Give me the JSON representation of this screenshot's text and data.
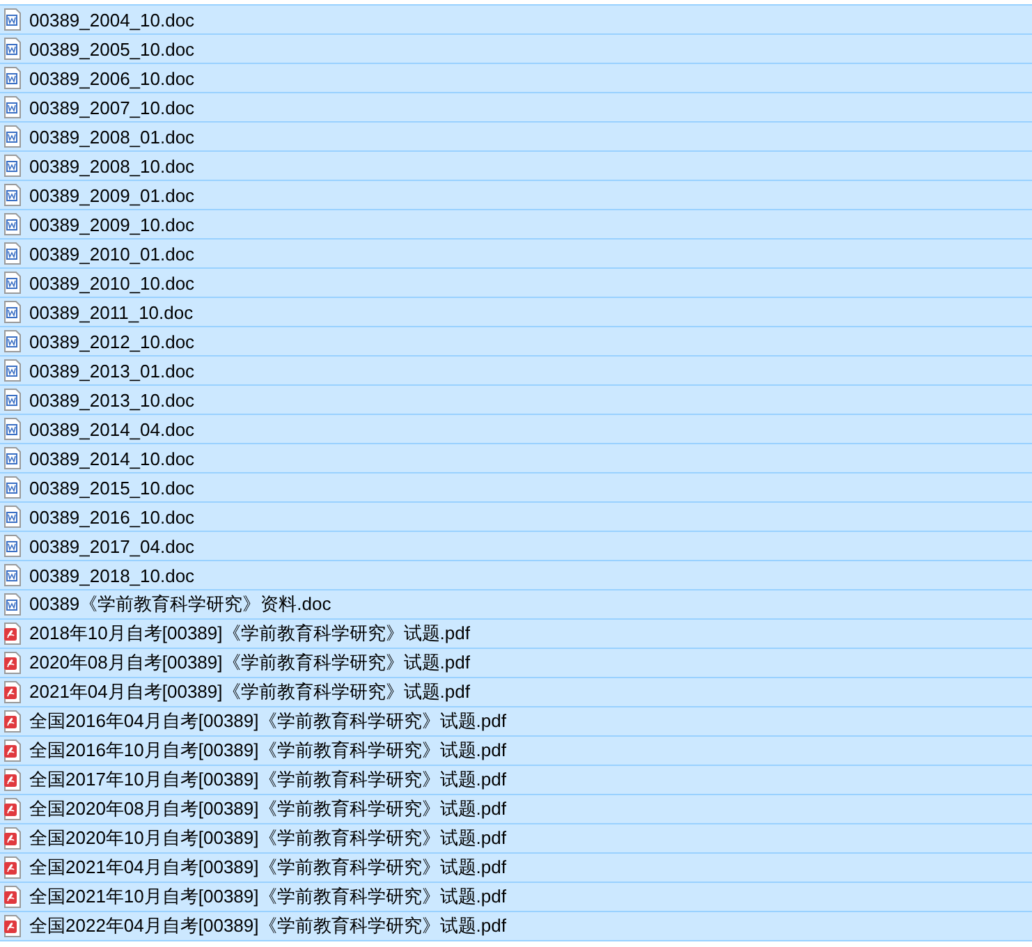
{
  "files": [
    {
      "name": "00389_2004_10.doc",
      "kind": "doc",
      "selected": true
    },
    {
      "name": "00389_2005_10.doc",
      "kind": "doc",
      "selected": true
    },
    {
      "name": "00389_2006_10.doc",
      "kind": "doc",
      "selected": true
    },
    {
      "name": "00389_2007_10.doc",
      "kind": "doc",
      "selected": true
    },
    {
      "name": "00389_2008_01.doc",
      "kind": "doc",
      "selected": true
    },
    {
      "name": "00389_2008_10.doc",
      "kind": "doc",
      "selected": true
    },
    {
      "name": "00389_2009_01.doc",
      "kind": "doc",
      "selected": true
    },
    {
      "name": "00389_2009_10.doc",
      "kind": "doc",
      "selected": true
    },
    {
      "name": "00389_2010_01.doc",
      "kind": "doc",
      "selected": true
    },
    {
      "name": "00389_2010_10.doc",
      "kind": "doc",
      "selected": true
    },
    {
      "name": "00389_2011_10.doc",
      "kind": "doc",
      "selected": true
    },
    {
      "name": "00389_2012_10.doc",
      "kind": "doc",
      "selected": true
    },
    {
      "name": "00389_2013_01.doc",
      "kind": "doc",
      "selected": true
    },
    {
      "name": "00389_2013_10.doc",
      "kind": "doc",
      "selected": true
    },
    {
      "name": "00389_2014_04.doc",
      "kind": "doc",
      "selected": true
    },
    {
      "name": "00389_2014_10.doc",
      "kind": "doc",
      "selected": true
    },
    {
      "name": "00389_2015_10.doc",
      "kind": "doc",
      "selected": true
    },
    {
      "name": "00389_2016_10.doc",
      "kind": "doc",
      "selected": true
    },
    {
      "name": "00389_2017_04.doc",
      "kind": "doc",
      "selected": true
    },
    {
      "name": "00389_2018_10.doc",
      "kind": "doc",
      "selected": true
    },
    {
      "name": "00389《学前教育科学研究》资料.doc",
      "kind": "doc",
      "selected": true
    },
    {
      "name": "2018年10月自考[00389]《学前教育科学研究》试题.pdf",
      "kind": "pdf",
      "selected": true
    },
    {
      "name": "2020年08月自考[00389]《学前教育科学研究》试题.pdf",
      "kind": "pdf",
      "selected": true
    },
    {
      "name": "2021年04月自考[00389]《学前教育科学研究》试题.pdf",
      "kind": "pdf",
      "selected": true
    },
    {
      "name": "全国2016年04月自考[00389]《学前教育科学研究》试题.pdf",
      "kind": "pdf",
      "selected": true
    },
    {
      "name": "全国2016年10月自考[00389]《学前教育科学研究》试题.pdf",
      "kind": "pdf",
      "selected": true
    },
    {
      "name": "全国2017年10月自考[00389]《学前教育科学研究》试题.pdf",
      "kind": "pdf",
      "selected": true
    },
    {
      "name": "全国2020年08月自考[00389]《学前教育科学研究》试题.pdf",
      "kind": "pdf",
      "selected": true
    },
    {
      "name": "全国2020年10月自考[00389]《学前教育科学研究》试题.pdf",
      "kind": "pdf",
      "selected": true
    },
    {
      "name": "全国2021年04月自考[00389]《学前教育科学研究》试题.pdf",
      "kind": "pdf",
      "selected": true
    },
    {
      "name": "全国2021年10月自考[00389]《学前教育科学研究》试题.pdf",
      "kind": "pdf",
      "selected": true
    },
    {
      "name": "全国2022年04月自考[00389]《学前教育科学研究》试题.pdf",
      "kind": "pdf",
      "selected": true
    }
  ]
}
